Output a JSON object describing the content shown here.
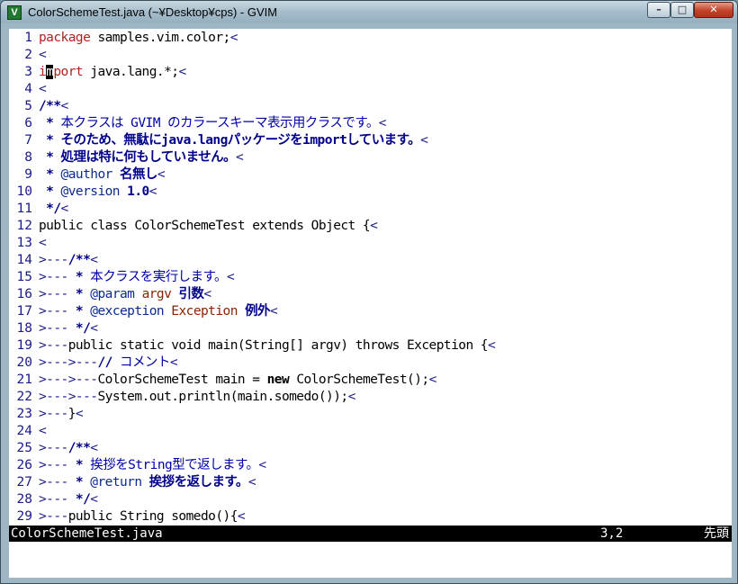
{
  "window": {
    "title": "ColorSchemeTest.java (~¥Desktop¥cps) - GVIM",
    "app_icon": "gvim-icon",
    "controls": {
      "minimize": "–",
      "maximize": "□",
      "close": "✕"
    }
  },
  "editor": {
    "lines": [
      {
        "n": "1",
        "segs": [
          {
            "t": "package",
            "c": "c-kw"
          },
          {
            "t": " samples.vim.color;",
            "c": "c-def"
          },
          {
            "t": "<",
            "c": "c-ws"
          }
        ]
      },
      {
        "n": "2",
        "segs": [
          {
            "t": "<",
            "c": "c-ws"
          }
        ]
      },
      {
        "n": "3",
        "segs": [
          {
            "t": "i",
            "c": "c-kw"
          },
          {
            "t": "m",
            "c": "cursor"
          },
          {
            "t": "port",
            "c": "c-kw"
          },
          {
            "t": " java.lang.*;",
            "c": "c-def"
          },
          {
            "t": "<",
            "c": "c-ws"
          }
        ]
      },
      {
        "n": "4",
        "segs": [
          {
            "t": "<",
            "c": "c-ws"
          }
        ]
      },
      {
        "n": "5",
        "segs": [
          {
            "t": "/**",
            "c": "c-cm2"
          },
          {
            "t": "<",
            "c": "c-ws"
          }
        ]
      },
      {
        "n": "6",
        "segs": [
          {
            "t": " * ",
            "c": "c-cm2"
          },
          {
            "t": "本クラスは GVIM のカラースキーマ表示用クラスです。",
            "c": "c-com"
          },
          {
            "t": "<",
            "c": "c-ws"
          }
        ]
      },
      {
        "n": "7",
        "segs": [
          {
            "t": " * そのため、無駄にjava.langパッケージをimportしています。",
            "c": "c-cm2"
          },
          {
            "t": "<",
            "c": "c-ws"
          }
        ]
      },
      {
        "n": "8",
        "segs": [
          {
            "t": " * 処理は特に何もしていません。",
            "c": "c-cm2"
          },
          {
            "t": "<",
            "c": "c-ws"
          }
        ]
      },
      {
        "n": "9",
        "segs": [
          {
            "t": " * ",
            "c": "c-cm2"
          },
          {
            "t": "@author",
            "c": "c-tag"
          },
          {
            "t": " 名無し",
            "c": "c-cm2"
          },
          {
            "t": "<",
            "c": "c-ws"
          }
        ]
      },
      {
        "n": "10",
        "segs": [
          {
            "t": " * ",
            "c": "c-cm2"
          },
          {
            "t": "@version",
            "c": "c-tag"
          },
          {
            "t": " 1.0",
            "c": "c-cm2"
          },
          {
            "t": "<",
            "c": "c-ws"
          }
        ]
      },
      {
        "n": "11",
        "segs": [
          {
            "t": " */",
            "c": "c-cm2"
          },
          {
            "t": "<",
            "c": "c-ws"
          }
        ]
      },
      {
        "n": "12",
        "segs": [
          {
            "t": "public class ColorSchemeTest extends Object {",
            "c": "c-def"
          },
          {
            "t": "<",
            "c": "c-ws"
          }
        ]
      },
      {
        "n": "13",
        "segs": [
          {
            "t": "<",
            "c": "c-ws"
          }
        ]
      },
      {
        "n": "14",
        "segs": [
          {
            "t": ">---",
            "c": "c-ws"
          },
          {
            "t": "/**",
            "c": "c-cm2"
          },
          {
            "t": "<",
            "c": "c-ws"
          }
        ]
      },
      {
        "n": "15",
        "segs": [
          {
            "t": ">---",
            "c": "c-ws"
          },
          {
            "t": " * ",
            "c": "c-cm2"
          },
          {
            "t": "本クラスを実行します。",
            "c": "c-com"
          },
          {
            "t": "<",
            "c": "c-ws"
          }
        ]
      },
      {
        "n": "16",
        "segs": [
          {
            "t": ">---",
            "c": "c-ws"
          },
          {
            "t": " * ",
            "c": "c-cm2"
          },
          {
            "t": "@param",
            "c": "c-tag"
          },
          {
            "t": " ",
            "c": "c-def"
          },
          {
            "t": "argv",
            "c": "c-key"
          },
          {
            "t": " 引数",
            "c": "c-cm2"
          },
          {
            "t": "<",
            "c": "c-ws"
          }
        ]
      },
      {
        "n": "17",
        "segs": [
          {
            "t": ">---",
            "c": "c-ws"
          },
          {
            "t": " * ",
            "c": "c-cm2"
          },
          {
            "t": "@exception",
            "c": "c-tag"
          },
          {
            "t": " ",
            "c": "c-def"
          },
          {
            "t": "Exception",
            "c": "c-key"
          },
          {
            "t": " 例外",
            "c": "c-cm2"
          },
          {
            "t": "<",
            "c": "c-ws"
          }
        ]
      },
      {
        "n": "18",
        "segs": [
          {
            "t": ">---",
            "c": "c-ws"
          },
          {
            "t": " */",
            "c": "c-cm2"
          },
          {
            "t": "<",
            "c": "c-ws"
          }
        ]
      },
      {
        "n": "19",
        "segs": [
          {
            "t": ">---",
            "c": "c-ws"
          },
          {
            "t": "public static void main(String[] argv) throws Exception {",
            "c": "c-def"
          },
          {
            "t": "<",
            "c": "c-ws"
          }
        ]
      },
      {
        "n": "20",
        "segs": [
          {
            "t": ">--->---",
            "c": "c-ws"
          },
          {
            "t": "// ",
            "c": "c-cm2"
          },
          {
            "t": "コメント",
            "c": "c-com"
          },
          {
            "t": "<",
            "c": "c-ws"
          }
        ]
      },
      {
        "n": "21",
        "segs": [
          {
            "t": ">--->---",
            "c": "c-ws"
          },
          {
            "t": "ColorSchemeTest main = ",
            "c": "c-def"
          },
          {
            "t": "new",
            "c": "c-bold"
          },
          {
            "t": " ColorSchemeTest();",
            "c": "c-def"
          },
          {
            "t": "<",
            "c": "c-ws"
          }
        ]
      },
      {
        "n": "22",
        "segs": [
          {
            "t": ">--->---",
            "c": "c-ws"
          },
          {
            "t": "System.out.println(main.somedo());",
            "c": "c-def"
          },
          {
            "t": "<",
            "c": "c-ws"
          }
        ]
      },
      {
        "n": "23",
        "segs": [
          {
            "t": ">---",
            "c": "c-ws"
          },
          {
            "t": "}",
            "c": "c-def"
          },
          {
            "t": "<",
            "c": "c-ws"
          }
        ]
      },
      {
        "n": "24",
        "segs": [
          {
            "t": "<",
            "c": "c-ws"
          }
        ]
      },
      {
        "n": "25",
        "segs": [
          {
            "t": ">---",
            "c": "c-ws"
          },
          {
            "t": "/**",
            "c": "c-cm2"
          },
          {
            "t": "<",
            "c": "c-ws"
          }
        ]
      },
      {
        "n": "26",
        "segs": [
          {
            "t": ">---",
            "c": "c-ws"
          },
          {
            "t": " * ",
            "c": "c-cm2"
          },
          {
            "t": "挨拶をString型で返します。",
            "c": "c-com"
          },
          {
            "t": "<",
            "c": "c-ws"
          }
        ]
      },
      {
        "n": "27",
        "segs": [
          {
            "t": ">---",
            "c": "c-ws"
          },
          {
            "t": " * ",
            "c": "c-cm2"
          },
          {
            "t": "@return",
            "c": "c-tag"
          },
          {
            "t": " 挨拶を返します。",
            "c": "c-cm2"
          },
          {
            "t": "<",
            "c": "c-ws"
          }
        ]
      },
      {
        "n": "28",
        "segs": [
          {
            "t": ">---",
            "c": "c-ws"
          },
          {
            "t": " */",
            "c": "c-cm2"
          },
          {
            "t": "<",
            "c": "c-ws"
          }
        ]
      },
      {
        "n": "29",
        "segs": [
          {
            "t": ">---",
            "c": "c-ws"
          },
          {
            "t": "public String somedo(){",
            "c": "c-def"
          },
          {
            "t": "<",
            "c": "c-ws"
          }
        ]
      }
    ]
  },
  "statusline": {
    "filename": "ColorSchemeTest.java",
    "position": "3,2",
    "scroll": "先頭"
  },
  "cmdline": {
    "text": ""
  }
}
